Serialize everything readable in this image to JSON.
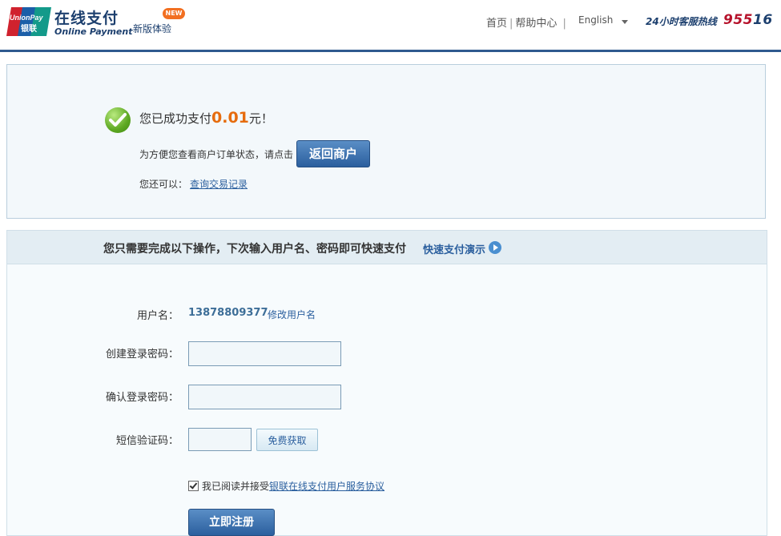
{
  "header": {
    "brand_title": "在线支付",
    "brand_subtitle": "Online Payment",
    "logo_text_top": "UnionPay",
    "logo_text_bottom": "银联",
    "new_experience": "新版体验",
    "new_badge": "NEW",
    "nav": [
      "首页",
      "帮助中心"
    ],
    "language": "English",
    "hotline_label": "24小时客服热线",
    "hotline_number_a": "955",
    "hotline_number_b": "16"
  },
  "success": {
    "message_prefix": "您已成功支付",
    "amount": "0.01",
    "message_suffix": "元！",
    "hint": "为方便您查看商户订单状态，请点击",
    "return_button": "返回商户",
    "also_label": "您还可以：",
    "query_link": "查询交易记录"
  },
  "register": {
    "title": "您只需要完成以下操作，下次输入用户名、密码即可快速支付",
    "demo_link": "快速支付演示",
    "username_label": "用户名：",
    "username_value": "13878809377",
    "edit_username": "修改用户名",
    "password_label": "创建登录密码：",
    "password_value": "",
    "confirm_label": "确认登录密码：",
    "confirm_value": "",
    "sms_label": "短信验证码：",
    "sms_value": "",
    "sms_button": "免费获取",
    "agree_prefix": "我已阅读并接受",
    "agree_link": "银联在线支付用户服务协议",
    "agree_checked": true,
    "register_button": "立即注册"
  },
  "colors": {
    "brand_blue": "#1c3f6e",
    "accent_orange": "#e66c0e",
    "hotline_red": "#b6122b",
    "button_blue": "#2b5f9e"
  }
}
